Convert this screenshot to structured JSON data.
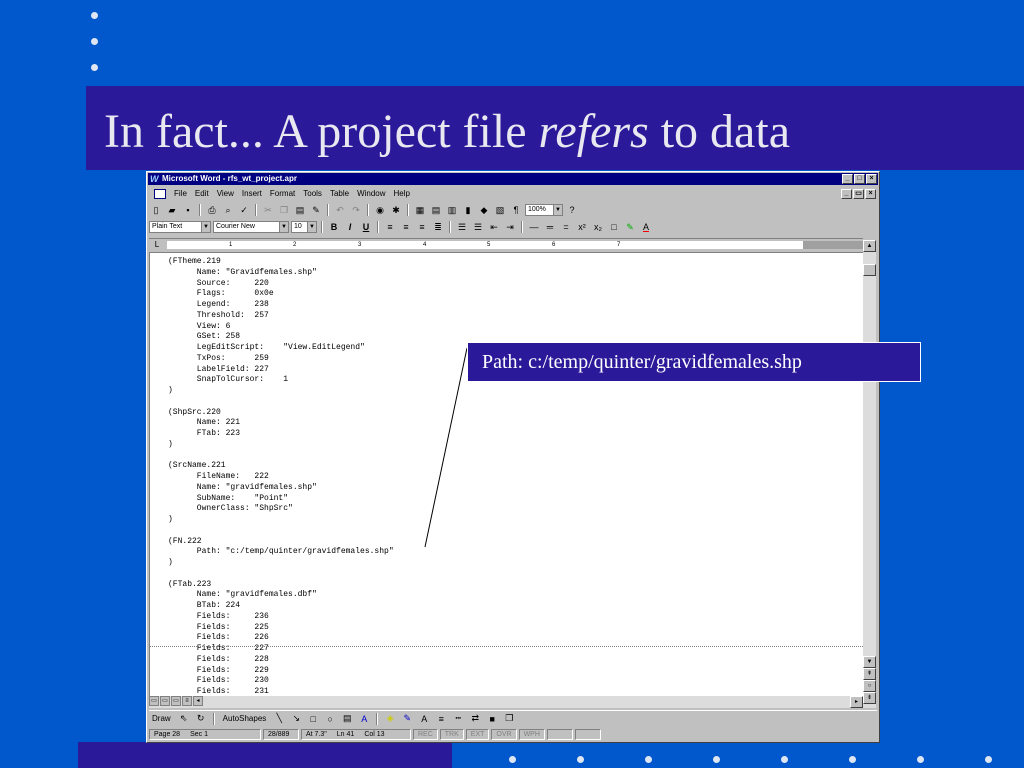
{
  "slide": {
    "title_before": "In fact... A project file ",
    "title_emphasis": "refers",
    "title_after": " to data",
    "callout": "Path: c:/temp/quinter/gravidfemales.shp"
  },
  "window": {
    "title": "Microsoft Word - rfs_wt_project.apr",
    "menu": [
      "File",
      "Edit",
      "View",
      "Insert",
      "Format",
      "Tools",
      "Table",
      "Window",
      "Help"
    ]
  },
  "toolbar": {
    "zoom": "100%",
    "style": "Plain Text",
    "font": "Courier New",
    "size": "10"
  },
  "ruler": [
    "1",
    "2",
    "3",
    "4",
    "5",
    "6",
    "7"
  ],
  "document": {
    "lines": [
      "(FTheme.219",
      "\tName: \"Gravidfemales.shp\"",
      "\tSource:     220",
      "\tFlags:      0x0e",
      "\tLegend:     238",
      "\tThreshold:  257",
      "\tView: 6",
      "\tGSet: 258",
      "\tLegEditScript:    \"View.EditLegend\"",
      "\tTxPos:      259",
      "\tLabelField: 227",
      "\tSnapTolCursor:    1",
      ")",
      "",
      "(ShpSrc.220",
      "\tName: 221",
      "\tFTab: 223",
      ")",
      "",
      "(SrcName.221",
      "\tFileName:   222",
      "\tName: \"gravidfemales.shp\"",
      "\tSubName:    \"Point\"",
      "\tOwnerClass: \"ShpSrc\"",
      ")",
      "",
      "(FN.222",
      "\tPath: \"c:/temp/quinter/gravidfemales.shp\"",
      ")",
      "",
      "(FTab.223",
      "\tName: \"gravidfemales.dbf\"",
      "\tBTab: 224",
      "\tFields:     236",
      "\tFields:     225",
      "\tFields:     226",
      "\tFields:     227",
      "\tFields:     228",
      "\tFields:     229",
      "\tFields:     230",
      "\tFields:     231"
    ]
  },
  "drawbar": {
    "draw": "Draw",
    "autoshapes": "AutoShapes"
  },
  "status": {
    "page": "Page 28",
    "sec": "Sec 1",
    "pages": "28/889",
    "at": "At 7.3\"",
    "ln": "Ln 41",
    "col": "Col 13",
    "rec": "REC",
    "trk": "TRK",
    "ext": "EXT",
    "ovr": "OVR",
    "wph": "WPH"
  }
}
